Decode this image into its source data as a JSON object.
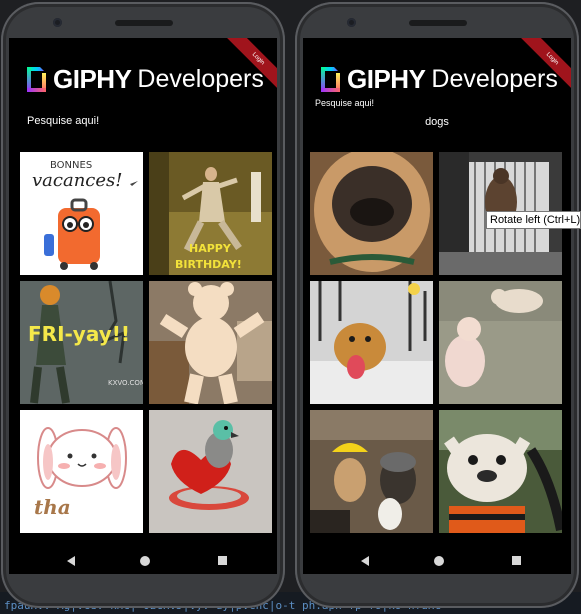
{
  "branding": {
    "logo_giphy": "GIPHY",
    "logo_developers": "Developers",
    "ribbon_text": "Login"
  },
  "left_phone": {
    "search_placeholder": "Pesquise aqui!",
    "tiles": [
      {
        "id": "bonnes-vacances",
        "texts": [
          "BONNES",
          "vacances!"
        ]
      },
      {
        "id": "happy-birthday",
        "texts": [
          "HAPPY",
          "BIRTHDAY!"
        ]
      },
      {
        "id": "fri-yay",
        "texts": [
          "FRI-yay!!",
          "KXVO.COM"
        ]
      },
      {
        "id": "dancing-bear",
        "texts": []
      },
      {
        "id": "bunny-thanks",
        "texts": [
          "tha"
        ]
      },
      {
        "id": "parrot-heart",
        "texts": []
      }
    ]
  },
  "right_phone": {
    "search_placeholder": "Pesquise aqui!",
    "search_value": "dogs",
    "tiles": [
      {
        "id": "pug-closeup"
      },
      {
        "id": "dog-at-door"
      },
      {
        "id": "golden-in-snow"
      },
      {
        "id": "puppy-and-baby"
      },
      {
        "id": "dogs-in-costumes"
      },
      {
        "id": "bulldog-in-car"
      }
    ]
  },
  "tooltip": {
    "text": "Rotate left (Ctrl+L)"
  },
  "ide_background_text": "fpauHV: Ag|vCe: kHC| OzcHVJ|vy: dy|pvcnc|o-t ph.aph-fp-fo|ko nfdHc"
}
